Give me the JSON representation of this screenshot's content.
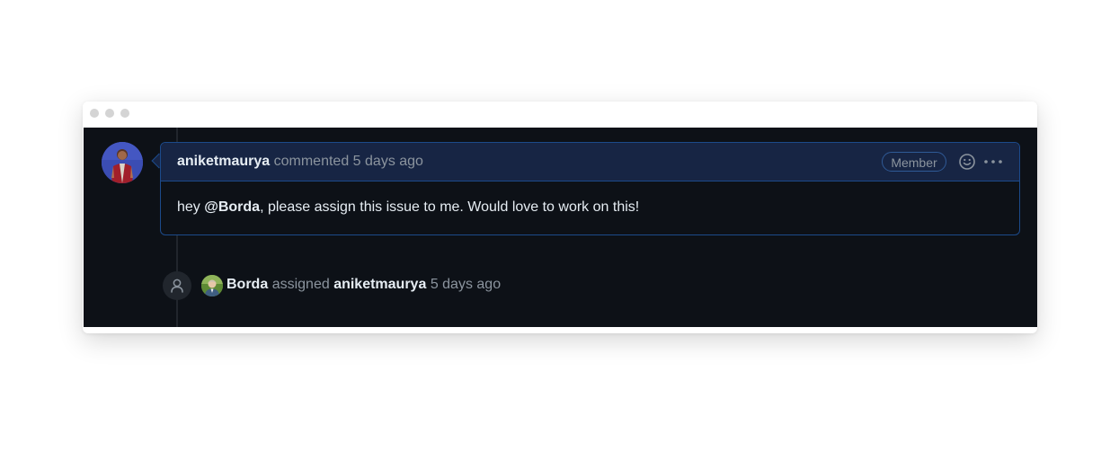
{
  "comment": {
    "author": "aniketmaurya",
    "action": "commented",
    "time": "5 days ago",
    "badge": "Member",
    "body_prefix": "hey ",
    "mention": "@Borda",
    "body_suffix": ", please assign this issue to me. Would love to work on this!"
  },
  "event": {
    "actor": "Borda",
    "action": "assigned",
    "target": "aniketmaurya",
    "time": "5 days ago"
  },
  "icons": {
    "reaction": "smiley-icon",
    "more": "kebab-horizontal-icon",
    "event": "person-icon"
  },
  "colors": {
    "background": "#0d1117",
    "header_background": "#172544",
    "border": "#1c4a8a",
    "text_primary": "#e6edf3",
    "text_muted": "#8b949e"
  }
}
